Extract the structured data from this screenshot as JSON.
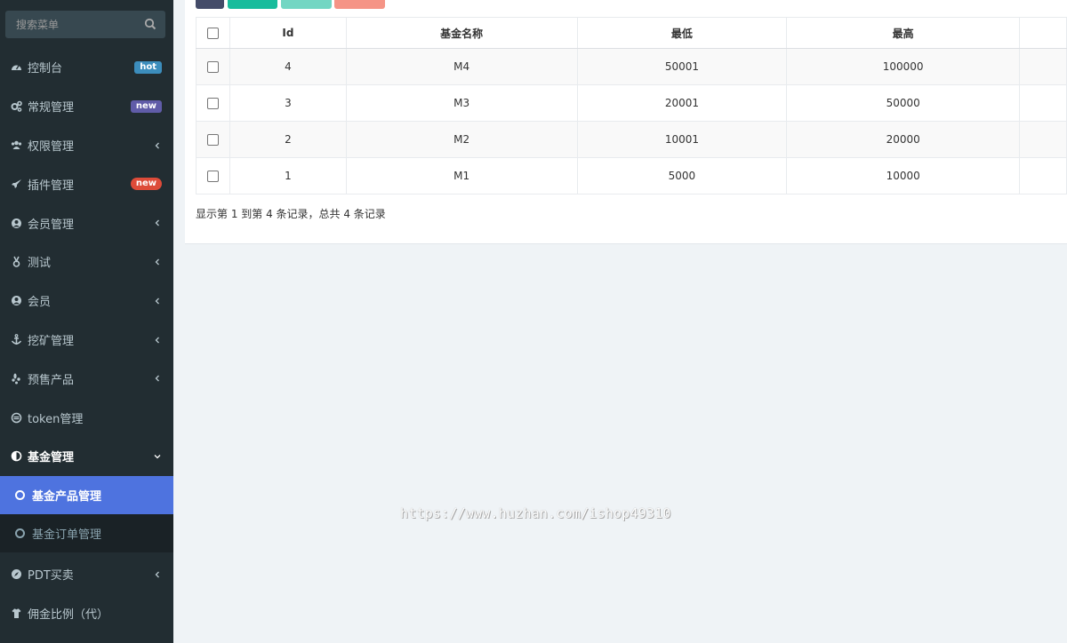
{
  "search": {
    "placeholder": "搜索菜单"
  },
  "menu": [
    {
      "label": "控制台",
      "icon": "dashboard-icon",
      "badge": "hot",
      "badge_color": "#3c8dbc"
    },
    {
      "label": "常规管理",
      "icon": "cogs-icon",
      "badge": "new",
      "badge_color": "#605ca8"
    },
    {
      "label": "权限管理",
      "icon": "users-icon"
    },
    {
      "label": "插件管理",
      "icon": "rocket-icon",
      "badge": "new",
      "badge_color": "#dd4b39"
    },
    {
      "label": "会员管理",
      "icon": "user-circle-icon"
    },
    {
      "label": "测试",
      "icon": "test-icon"
    },
    {
      "label": "会员",
      "icon": "user-circle-icon"
    },
    {
      "label": "挖矿管理",
      "icon": "anchor-icon"
    },
    {
      "label": "预售产品",
      "icon": "yelp-icon"
    },
    {
      "label": "token管理",
      "icon": "token-icon"
    },
    {
      "label": "基金管理",
      "icon": "adjust-icon"
    },
    {
      "label": "PDT买卖",
      "icon": "compass-icon"
    },
    {
      "label": "佣金比例（代）",
      "icon": "tshirt-icon"
    }
  ],
  "submenu": [
    {
      "label": "基金产品管理"
    },
    {
      "label": "基金订单管理"
    }
  ],
  "table": {
    "columns": [
      "Id",
      "基金名称",
      "最低",
      "最高"
    ],
    "rows": [
      [
        "4",
        "M4",
        "50001",
        "100000"
      ],
      [
        "3",
        "M3",
        "20001",
        "50000"
      ],
      [
        "2",
        "M2",
        "10001",
        "20000"
      ],
      [
        "1",
        "M1",
        "5000",
        "10000"
      ]
    ]
  },
  "pagination": {
    "summary": "显示第 1 到第 4 条记录，总共 4 条记录"
  },
  "toolbar_colors": [
    "#444c69",
    "#18bc9c",
    "#73d6c3",
    "#f59486"
  ],
  "active_color": "#4e73df",
  "watermark": "https://www.huzhan.com/ishop49310"
}
